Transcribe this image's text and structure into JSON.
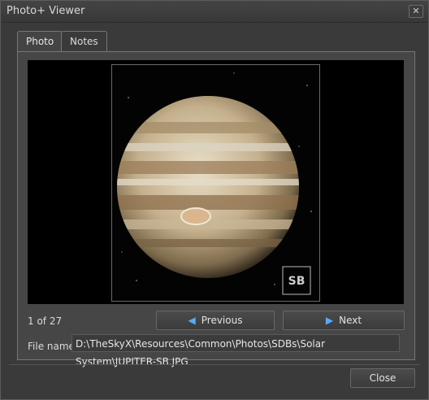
{
  "window": {
    "title": "Photo+ Viewer",
    "close_glyph": "✕"
  },
  "tabs": [
    {
      "label": "Photo",
      "active": true
    },
    {
      "label": "Notes",
      "active": false
    }
  ],
  "photo": {
    "subject": "Jupiter",
    "watermark": "SB"
  },
  "navigation": {
    "counter": "1 of 27",
    "previous_label": "Previous",
    "next_label": "Next"
  },
  "file": {
    "label": "File name:",
    "value": "D:\\TheSkyX\\Resources\\Common\\Photos\\SDBs\\Solar System\\JUPITER-SB.JPG"
  },
  "footer": {
    "close_label": "Close"
  },
  "colors": {
    "accent": "#5aa9ff",
    "background": "#3a3a3a"
  }
}
